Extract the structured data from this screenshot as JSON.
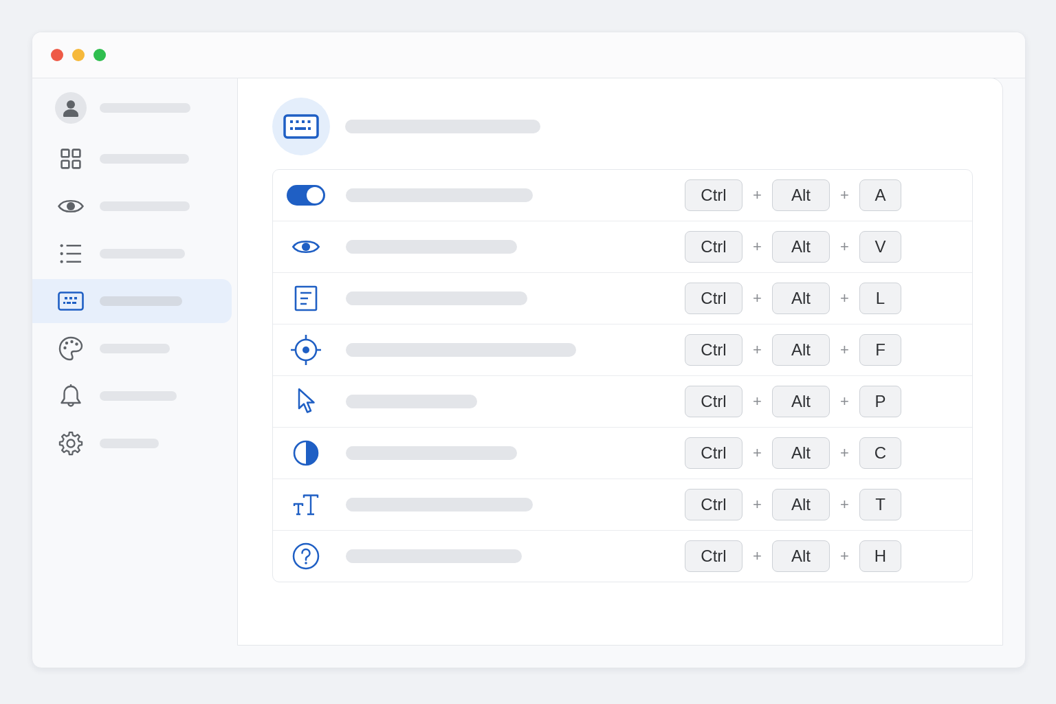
{
  "window": {
    "controls": [
      {
        "color": "#ee5a47"
      },
      {
        "color": "#f6b93b"
      },
      {
        "color": "#2fbe4f"
      }
    ]
  },
  "sidebar": {
    "items": [
      {
        "kind": "avatar",
        "selected": false
      },
      {
        "kind": "nav",
        "selected": false
      },
      {
        "kind": "nav",
        "selected": false
      },
      {
        "kind": "nav",
        "selected": false
      },
      {
        "kind": "nav",
        "selected": true
      },
      {
        "kind": "nav",
        "selected": false
      },
      {
        "kind": "nav",
        "selected": false
      },
      {
        "kind": "nav",
        "selected": false
      }
    ]
  },
  "panel": {
    "shortcuts": [
      {
        "kind": "toggle",
        "on": true,
        "combo": [
          {
            "kind": "key",
            "label": "Ctrl"
          },
          {
            "kind": "plus",
            "label": "+"
          },
          {
            "kind": "key",
            "label": "Alt"
          },
          {
            "kind": "plus",
            "label": "+"
          },
          {
            "kind": "key",
            "label": "A"
          }
        ]
      },
      {
        "kind": "icon",
        "combo": [
          {
            "kind": "key",
            "label": "Ctrl"
          },
          {
            "kind": "plus",
            "label": "+"
          },
          {
            "kind": "key",
            "label": "Alt"
          },
          {
            "kind": "plus",
            "label": "+"
          },
          {
            "kind": "key",
            "label": "V"
          }
        ]
      },
      {
        "kind": "icon",
        "combo": [
          {
            "kind": "key",
            "label": "Ctrl"
          },
          {
            "kind": "plus",
            "label": "+"
          },
          {
            "kind": "key",
            "label": "Alt"
          },
          {
            "kind": "plus",
            "label": "+"
          },
          {
            "kind": "key",
            "label": "L"
          }
        ]
      },
      {
        "kind": "icon",
        "combo": [
          {
            "kind": "key",
            "label": "Ctrl"
          },
          {
            "kind": "plus",
            "label": "+"
          },
          {
            "kind": "key",
            "label": "Alt"
          },
          {
            "kind": "plus",
            "label": "+"
          },
          {
            "kind": "key",
            "label": "F"
          }
        ]
      },
      {
        "kind": "icon",
        "combo": [
          {
            "kind": "key",
            "label": "Ctrl"
          },
          {
            "kind": "plus",
            "label": "+"
          },
          {
            "kind": "key",
            "label": "Alt"
          },
          {
            "kind": "plus",
            "label": "+"
          },
          {
            "kind": "key",
            "label": "P"
          }
        ]
      },
      {
        "kind": "icon",
        "combo": [
          {
            "kind": "key",
            "label": "Ctrl"
          },
          {
            "kind": "plus",
            "label": "+"
          },
          {
            "kind": "key",
            "label": "Alt"
          },
          {
            "kind": "plus",
            "label": "+"
          },
          {
            "kind": "key",
            "label": "C"
          }
        ]
      },
      {
        "kind": "icon",
        "combo": [
          {
            "kind": "key",
            "label": "Ctrl"
          },
          {
            "kind": "plus",
            "label": "+"
          },
          {
            "kind": "key",
            "label": "Alt"
          },
          {
            "kind": "plus",
            "label": "+"
          },
          {
            "kind": "key",
            "label": "T"
          }
        ]
      },
      {
        "kind": "icon",
        "combo": [
          {
            "kind": "key",
            "label": "Ctrl"
          },
          {
            "kind": "plus",
            "label": "+"
          },
          {
            "kind": "key",
            "label": "Alt"
          },
          {
            "kind": "plus",
            "label": "+"
          },
          {
            "kind": "key",
            "label": "H"
          }
        ]
      }
    ]
  }
}
